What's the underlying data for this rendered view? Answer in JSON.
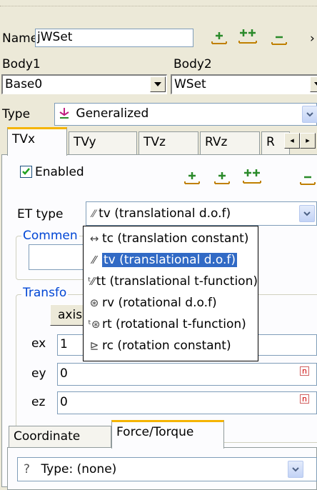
{
  "name": {
    "label": "Name",
    "value": "jWSet"
  },
  "toolbar_top": {
    "icons": [
      "add-icon",
      "add-pair-icon",
      "remove-icon"
    ],
    "more": "›"
  },
  "bodies": {
    "body1_label": "Body1",
    "body2_label": "Body2",
    "body1_value": "Base0",
    "body2_value": "WSet"
  },
  "type": {
    "label": "Type",
    "value": "Generalized"
  },
  "tabs": {
    "items": [
      "TVx",
      "TVy",
      "TVz",
      "RVz",
      "R"
    ],
    "active": "TVx",
    "scroll_left": "◂",
    "scroll_right": "▸"
  },
  "enabled": {
    "label": "Enabled",
    "checked": true
  },
  "et_type": {
    "label": "ET type",
    "selected": "tv (translational d.o.f)",
    "options": [
      {
        "icon": "↔",
        "label": "tc (translation constant)"
      },
      {
        "icon": "⁄⁄",
        "label": "tv (translational d.o.f)",
        "selected": true
      },
      {
        "icon": "ᵗ⁄⁄",
        "label": "tt (translational t-function)"
      },
      {
        "icon": "⊛",
        "label": "rv (rotational d.o.f)"
      },
      {
        "icon": "ᵗ⊛",
        "label": "rt (rotational t-function)"
      },
      {
        "icon": "⊵",
        "label": "rc (rotation constant)"
      }
    ]
  },
  "comment": {
    "label": "Commen"
  },
  "transform": {
    "label": "Transfo",
    "axis_button": "axis"
  },
  "vectors": {
    "ex_label": "ex",
    "ex_value": "1",
    "ey_label": "ey",
    "ey_value": "0",
    "ez_label": "ez",
    "ez_value": "0",
    "red_flag": "n"
  },
  "bottom_tabs": {
    "items": [
      "Coordinate",
      "Force/Torque"
    ],
    "active": "Force/Torque"
  },
  "force_type": {
    "icon": "?",
    "value": "Type: (none)"
  },
  "colors": {
    "selection": "#316ac5",
    "group_title": "#0046d5",
    "active_tab_top": "#f5b400",
    "checkbox_check": "#21a121"
  }
}
